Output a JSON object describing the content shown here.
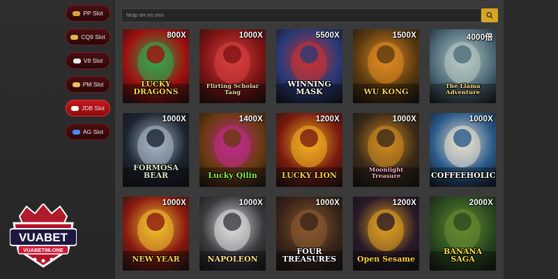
{
  "search": {
    "placeholder": "Nhập tên trò chơi"
  },
  "providers": [
    {
      "label": "PP Slot",
      "icon": "pp-logo-icon",
      "color": "#d9a33a",
      "active": false
    },
    {
      "label": "CQ9 Slot",
      "icon": "cq9-logo-icon",
      "color": "#e0b84a",
      "active": false
    },
    {
      "label": "V8 Slot",
      "icon": "v8-logo-icon",
      "color": "#e8e8e8",
      "active": false
    },
    {
      "label": "PM Slot",
      "icon": "pm-logo-icon",
      "color": "#f0c060",
      "active": false
    },
    {
      "label": "JDB Slot",
      "icon": "jdb-logo-icon",
      "color": "#ffffff",
      "active": true
    },
    {
      "label": "AG Slot",
      "icon": "ag-logo-icon",
      "color": "#4a8cff",
      "active": false
    }
  ],
  "games": [
    {
      "title": "LUCKY DRAGONS",
      "multiplier": "800X",
      "bg": "#a01010",
      "accent": "#2fa84a",
      "title_color": "#ffd34a"
    },
    {
      "title": "Flirting Scholar Tang",
      "multiplier": "1000X",
      "bg": "#7d1313",
      "accent": "#d94040",
      "title_color": "#ffd8a0"
    },
    {
      "title": "WINNING MASK",
      "multiplier": "5500X",
      "bg": "#2a3a78",
      "accent": "#c83232",
      "title_color": "#ffffff"
    },
    {
      "title": "WU KONG",
      "multiplier": "1500X",
      "bg": "#5a3a10",
      "accent": "#e08a20",
      "title_color": "#ffd050"
    },
    {
      "title": "The Llama Adventure",
      "multiplier": "4000倍",
      "bg": "#4f6b7a",
      "accent": "#b8c9c2",
      "title_color": "#ffe28a"
    },
    {
      "title": "FORMOSA BEAR",
      "multiplier": "1000X",
      "bg": "#1c2430",
      "accent": "#a8b8c8",
      "title_color": "#d8e8c8"
    },
    {
      "title": "Lucky Qilin",
      "multiplier": "1400X",
      "bg": "#6a3a10",
      "accent": "#c02a8a",
      "title_color": "#8af04a"
    },
    {
      "title": "LUCKY LION",
      "multiplier": "1200X",
      "bg": "#7a1a10",
      "accent": "#f0b020",
      "title_color": "#ffd040"
    },
    {
      "title": "Moonlight Treasure",
      "multiplier": "1000X",
      "bg": "#3a2a18",
      "accent": "#d08a20",
      "title_color": "#ffb0d0"
    },
    {
      "title": "COFFEEHOLICS",
      "multiplier": "1000X",
      "bg": "#2a5a8a",
      "accent": "#e8e0d0",
      "title_color": "#ffffff"
    },
    {
      "title": "NEW YEAR",
      "multiplier": "1000X",
      "bg": "#8a1a10",
      "accent": "#f0c030",
      "title_color": "#ffd040"
    },
    {
      "title": "NAPOLEON",
      "multiplier": "1000X",
      "bg": "#3a3a40",
      "accent": "#e0e0e0",
      "title_color": "#ffe08a"
    },
    {
      "title": "FOUR TREASURES",
      "multiplier": "1000X",
      "bg": "#3a2418",
      "accent": "#8a5a30",
      "title_color": "#ffffff"
    },
    {
      "title": "Open Sesame",
      "multiplier": "1200X",
      "bg": "#2a1a28",
      "accent": "#e0a020",
      "title_color": "#ffd040"
    },
    {
      "title": "BANANA SAGA",
      "multiplier": "2000X",
      "bg": "#2a4a20",
      "accent": "#6a8a30",
      "title_color": "#ffe040"
    }
  ],
  "logo": {
    "brand": "VUABET",
    "url": "VUABET88.ONE"
  }
}
